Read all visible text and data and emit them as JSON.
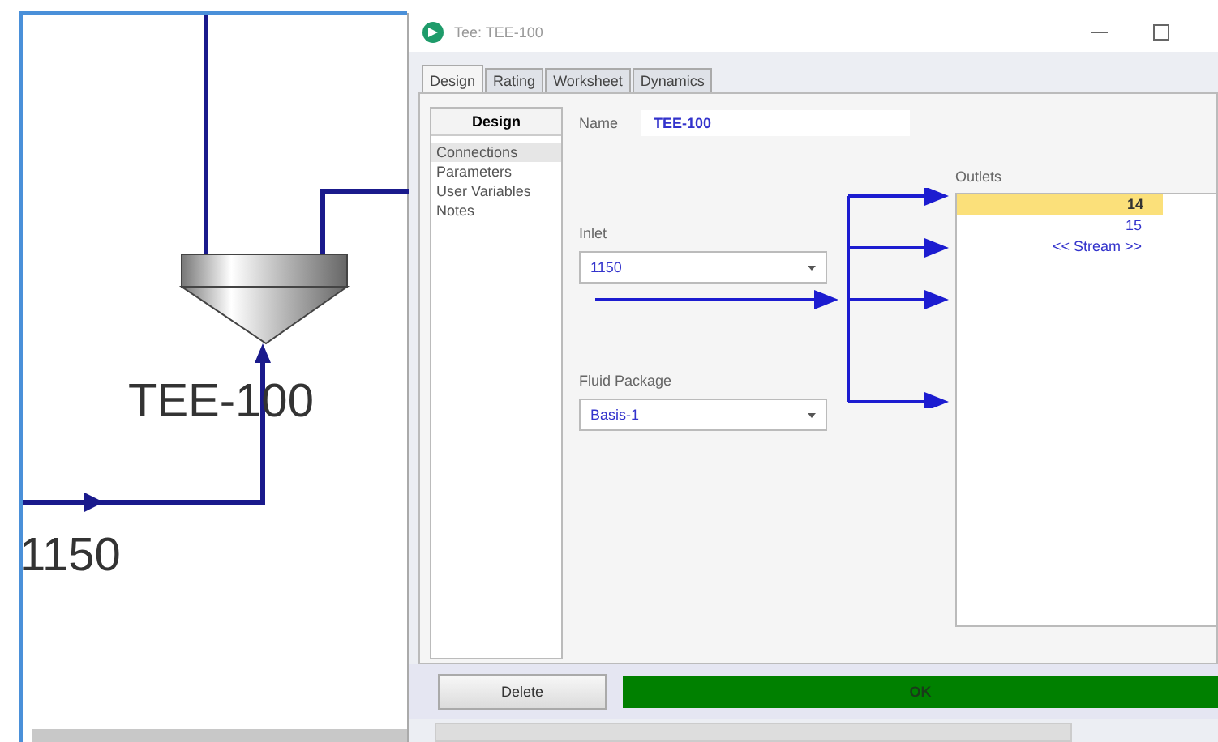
{
  "canvas": {
    "unit_label": "TEE-100",
    "stream_label": "1150"
  },
  "window": {
    "title": "Tee: TEE-100"
  },
  "tabs": [
    {
      "label": "Design",
      "selected": true
    },
    {
      "label": "Rating",
      "selected": false
    },
    {
      "label": "Worksheet",
      "selected": false
    },
    {
      "label": "Dynamics",
      "selected": false
    }
  ],
  "sidebar": {
    "header": "Design",
    "items": [
      {
        "label": "Connections",
        "selected": true
      },
      {
        "label": "Parameters",
        "selected": false
      },
      {
        "label": "User Variables",
        "selected": false
      },
      {
        "label": "Notes",
        "selected": false
      }
    ]
  },
  "name": {
    "label": "Name",
    "value": "TEE-100"
  },
  "inlet": {
    "label": "Inlet",
    "value": "1150"
  },
  "fluid_package": {
    "label": "Fluid Package",
    "value": "Basis-1"
  },
  "outlets": {
    "label": "Outlets",
    "rows": [
      {
        "text": "14",
        "selected": true
      },
      {
        "text": "15",
        "selected": false
      },
      {
        "text": "<< Stream >>",
        "selected": false
      }
    ]
  },
  "delete_button": "Delete",
  "status": "OK"
}
